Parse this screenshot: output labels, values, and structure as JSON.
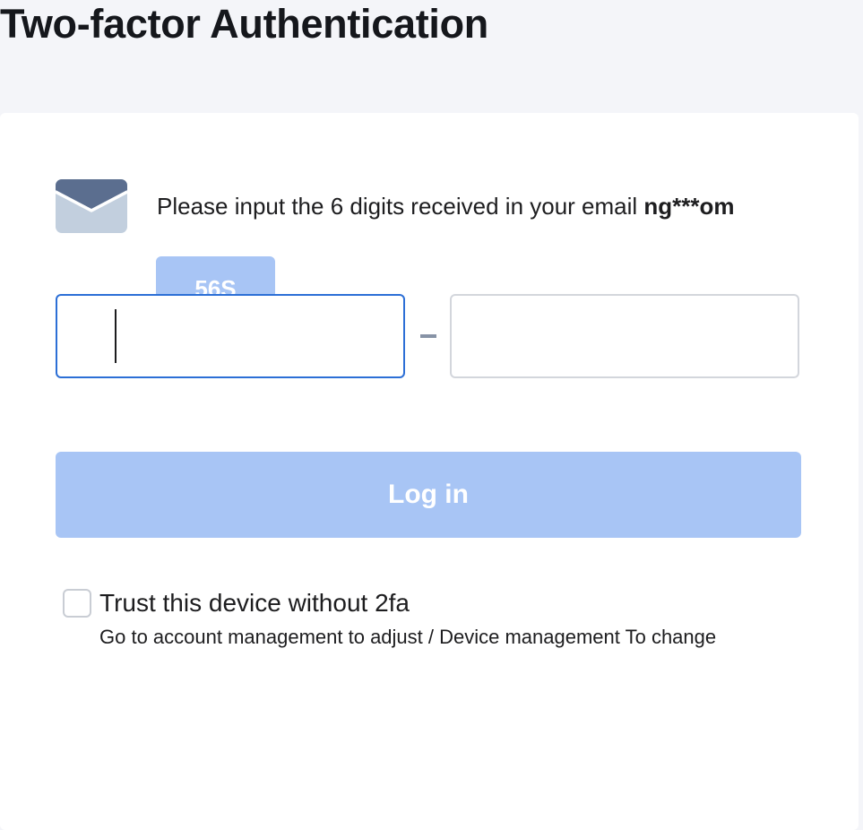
{
  "page": {
    "title": "Two-factor Authentication"
  },
  "verification": {
    "icon": "envelope-icon",
    "prompt": "Please input the 6 digits received in your email ",
    "masked_email": "ng***om",
    "countdown_label": "56S"
  },
  "code": {
    "separator": "-",
    "digits": [
      "",
      "",
      "",
      "",
      "",
      ""
    ]
  },
  "login": {
    "label": "Log in"
  },
  "trust": {
    "checked": false,
    "label": "Trust this device without 2fa",
    "hint": "Go to account management to adjust / Device management To change"
  },
  "colors": {
    "page_background": "#f4f5f9",
    "card_background": "#ffffff",
    "button_disabled": "#a8c5f5",
    "focus_border": "#2c6fd6",
    "envelope_flap": "#5b6e8f",
    "envelope_body": "#c2cfde"
  }
}
